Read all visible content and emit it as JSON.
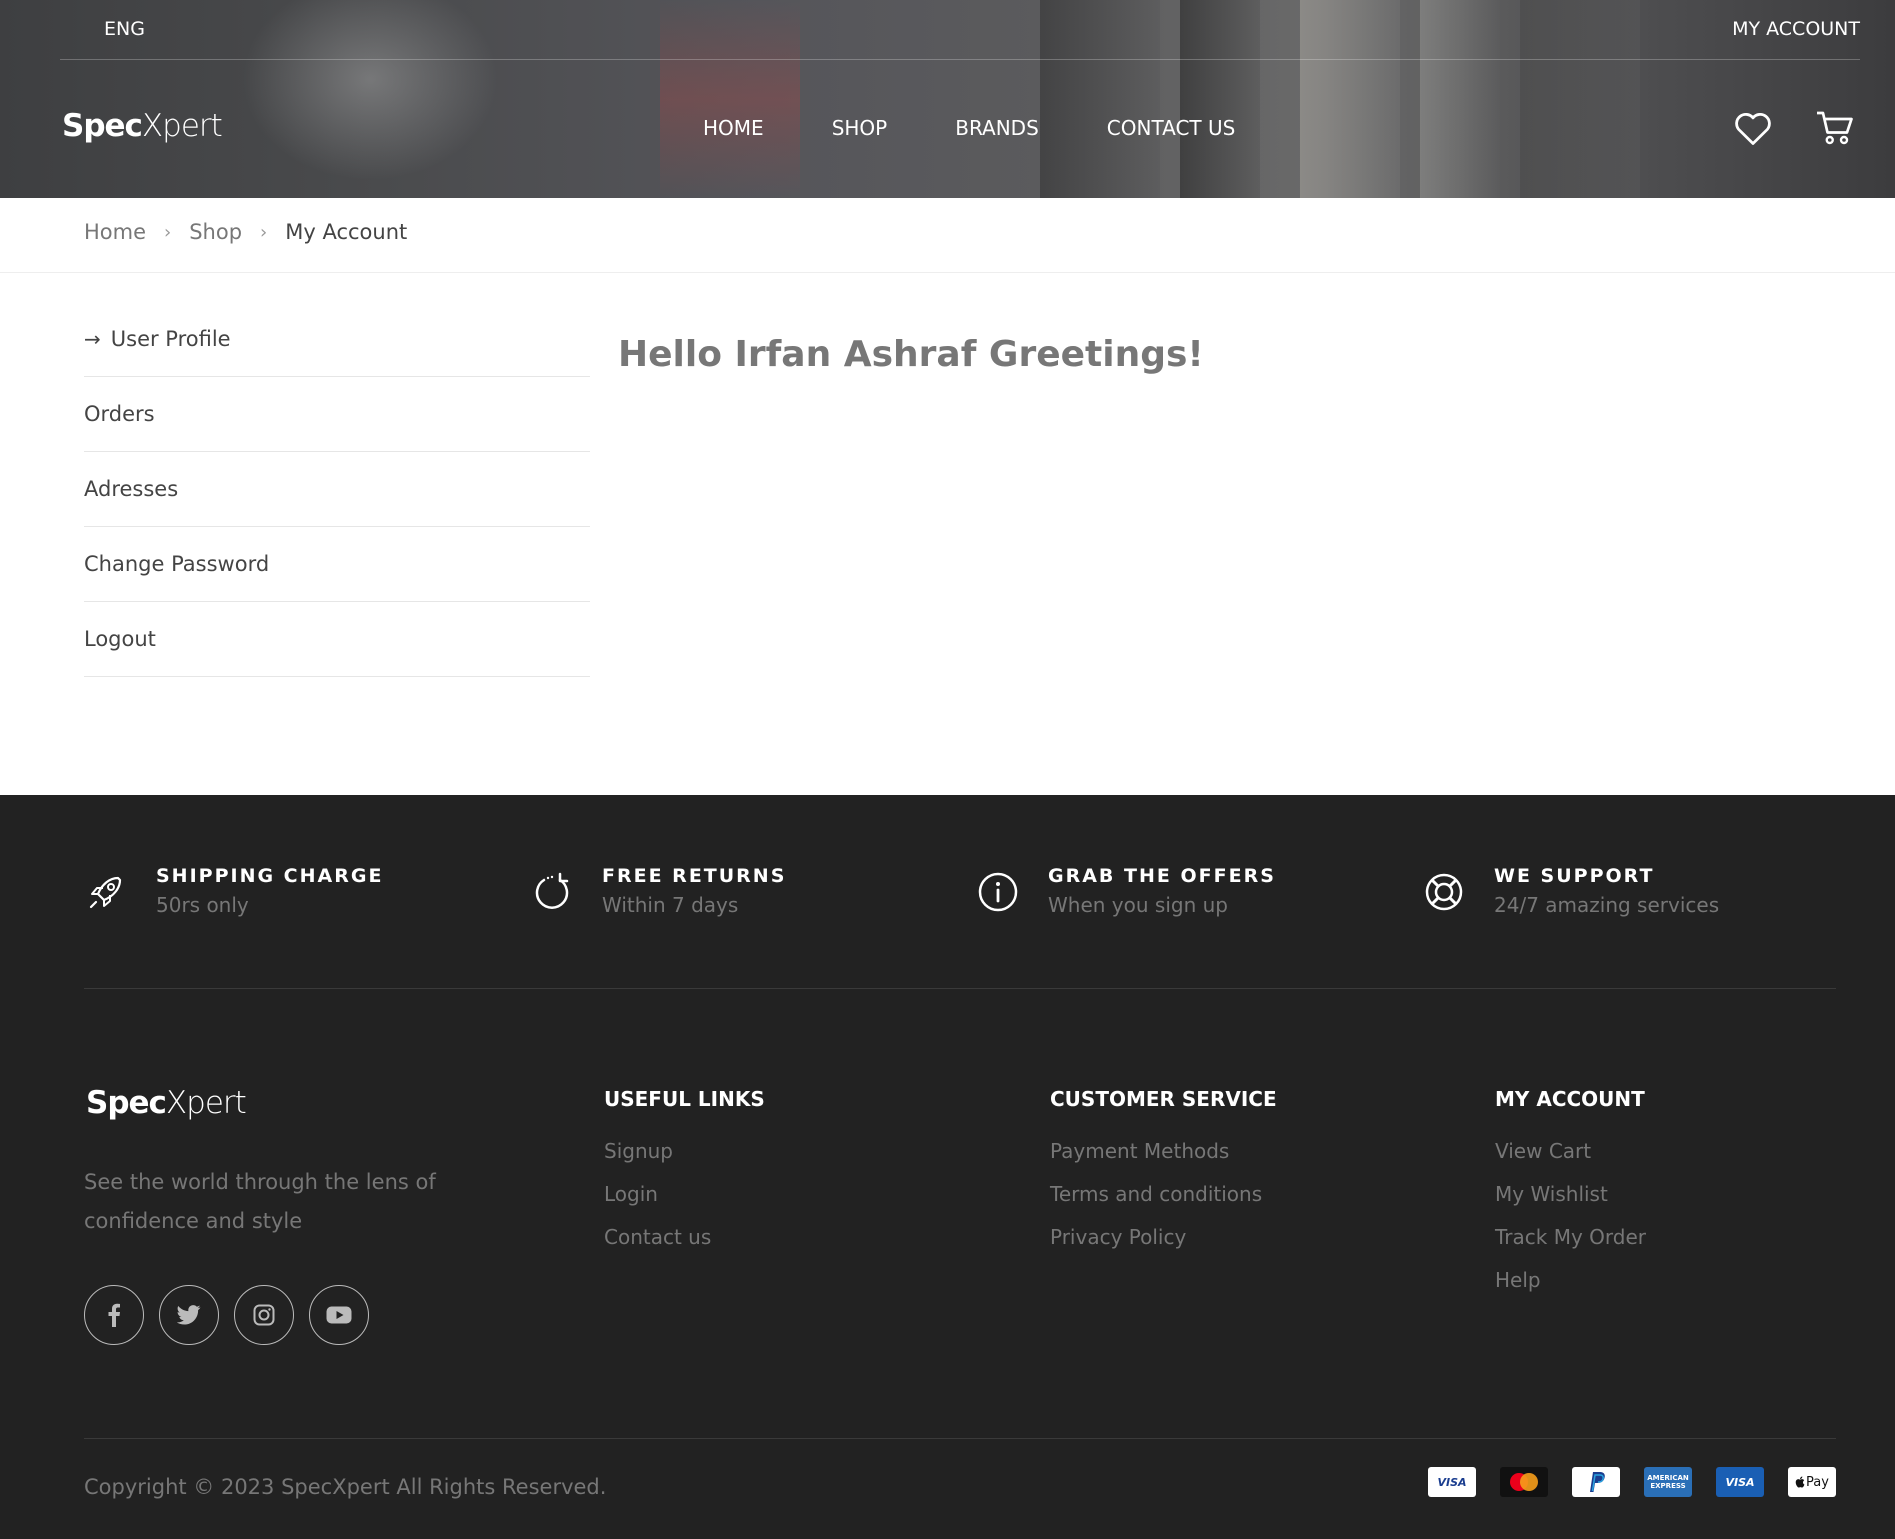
{
  "header": {
    "lang": "ENG",
    "account_link": "MY ACCOUNT",
    "logo_bold": "Spec",
    "logo_light": "Xpert",
    "nav": [
      "HOME",
      "SHOP",
      "BRANDS",
      "CONTACT US"
    ],
    "icons": [
      "heart-icon",
      "cart-icon"
    ]
  },
  "breadcrumb": {
    "items": [
      "Home",
      "Shop"
    ],
    "current": "My Account"
  },
  "sidebar": {
    "items": [
      "User Profile",
      "Orders",
      "Adresses",
      "Change Password",
      "Logout"
    ],
    "active_index": 0
  },
  "main": {
    "greeting": "Hello Irfan Ashraf Greetings!"
  },
  "footer": {
    "features": [
      {
        "title": "SHIPPING CHARGE",
        "sub": "50rs only",
        "icon": "rocket-icon"
      },
      {
        "title": "FREE RETURNS",
        "sub": "Within 7 days",
        "icon": "refresh-icon"
      },
      {
        "title": "GRAB THE OFFERS",
        "sub": "When you sign up",
        "icon": "info-icon"
      },
      {
        "title": "WE SUPPORT",
        "sub": "24/7 amazing services",
        "icon": "lifebuoy-icon"
      }
    ],
    "tagline": "See the world through the lens of confidence and style",
    "social_icons": [
      "facebook-icon",
      "twitter-icon",
      "instagram-icon",
      "youtube-icon"
    ],
    "columns": [
      {
        "heading": "USEFUL LINKS",
        "links": [
          "Signup",
          "Login",
          "Contact us"
        ]
      },
      {
        "heading": "CUSTOMER SERVICE",
        "links": [
          "Payment Methods",
          "Terms and conditions",
          "Privacy Policy"
        ]
      },
      {
        "heading": "MY ACCOUNT",
        "links": [
          "View Cart",
          "My Wishlist",
          "Track My Order",
          "Help"
        ]
      }
    ],
    "copyright": "Copyright © 2023 SpecXpert All Rights Reserved.",
    "payments": [
      {
        "name": "VISA",
        "bg": "#ffffff",
        "fg": "#1a3d8f"
      },
      {
        "name": "mastercard",
        "bg": "#111111",
        "fg": "#ffffff"
      },
      {
        "name": "PayPal",
        "bg": "#ffffff",
        "fg": "#1a3d8f"
      },
      {
        "name": "AMERICAN EXPRESS",
        "bg": "#2a6fb7",
        "fg": "#ffffff"
      },
      {
        "name": "VISA",
        "bg": "#1a5fb4",
        "fg": "#ffffff"
      },
      {
        "name": "Pay",
        "bg": "#ffffff",
        "fg": "#111111"
      }
    ]
  }
}
